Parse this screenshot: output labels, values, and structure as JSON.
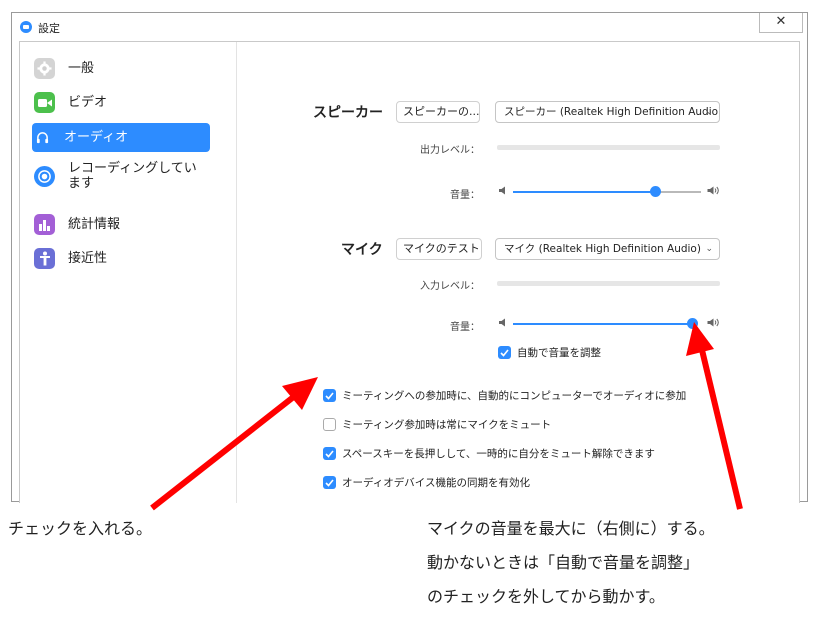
{
  "window": {
    "title": "設定",
    "close": "✕"
  },
  "sidebar": {
    "items": [
      {
        "label": "一般",
        "icon": "gear-icon",
        "color": "#cfcfcf",
        "active": false
      },
      {
        "label": "ビデオ",
        "icon": "video-icon",
        "color": "#4cc04c",
        "active": false
      },
      {
        "label": "オーディオ",
        "icon": "headphones-icon",
        "color": "#2d8cff",
        "active": true
      },
      {
        "label": "レコーディングしています",
        "icon": "record-icon",
        "color": "#2d8cff",
        "active": false
      },
      {
        "label": "統計情報",
        "icon": "stats-icon",
        "color": "#9c5fd6",
        "active": false
      },
      {
        "label": "接近性",
        "icon": "accessibility-icon",
        "color": "#6a6fd6",
        "active": false
      }
    ]
  },
  "speaker": {
    "title": "スピーカー",
    "test_button": "スピーカーの...",
    "device": "スピーカー (Realtek High Definition Audio)",
    "output_level_label": "出力レベル：",
    "volume_label": "音量：",
    "volume": 0.76
  },
  "mic": {
    "title": "マイク",
    "test_button": "マイクのテスト",
    "device": "マイク (Realtek High Definition Audio)",
    "input_level_label": "入力レベル：",
    "volume_label": "音量：",
    "volume": 1.0,
    "auto_adjust": {
      "label": "自動で音量を調整",
      "checked": true
    }
  },
  "options": [
    {
      "label": "ミーティングへの参加時に、自動的にコンピューターでオーディオに参加",
      "checked": true
    },
    {
      "label": "ミーティング参加時は常にマイクをミュート",
      "checked": false
    },
    {
      "label": "スペースキーを長押しして、一時的に自分をミュート解除できます",
      "checked": true
    },
    {
      "label": "オーディオデバイス機能の同期を有効化",
      "checked": true
    }
  ],
  "annotations": {
    "left_caption": "チェックを入れる。",
    "right_caption_1": "マイクの音量を最大に（右側に）する。",
    "right_caption_2": "動かないときは「自動で音量を調整」",
    "right_caption_3": "のチェックを外してから動かす。",
    "arrow_color": "#ff0000"
  },
  "colors": {
    "accent": "#2d8cff"
  }
}
